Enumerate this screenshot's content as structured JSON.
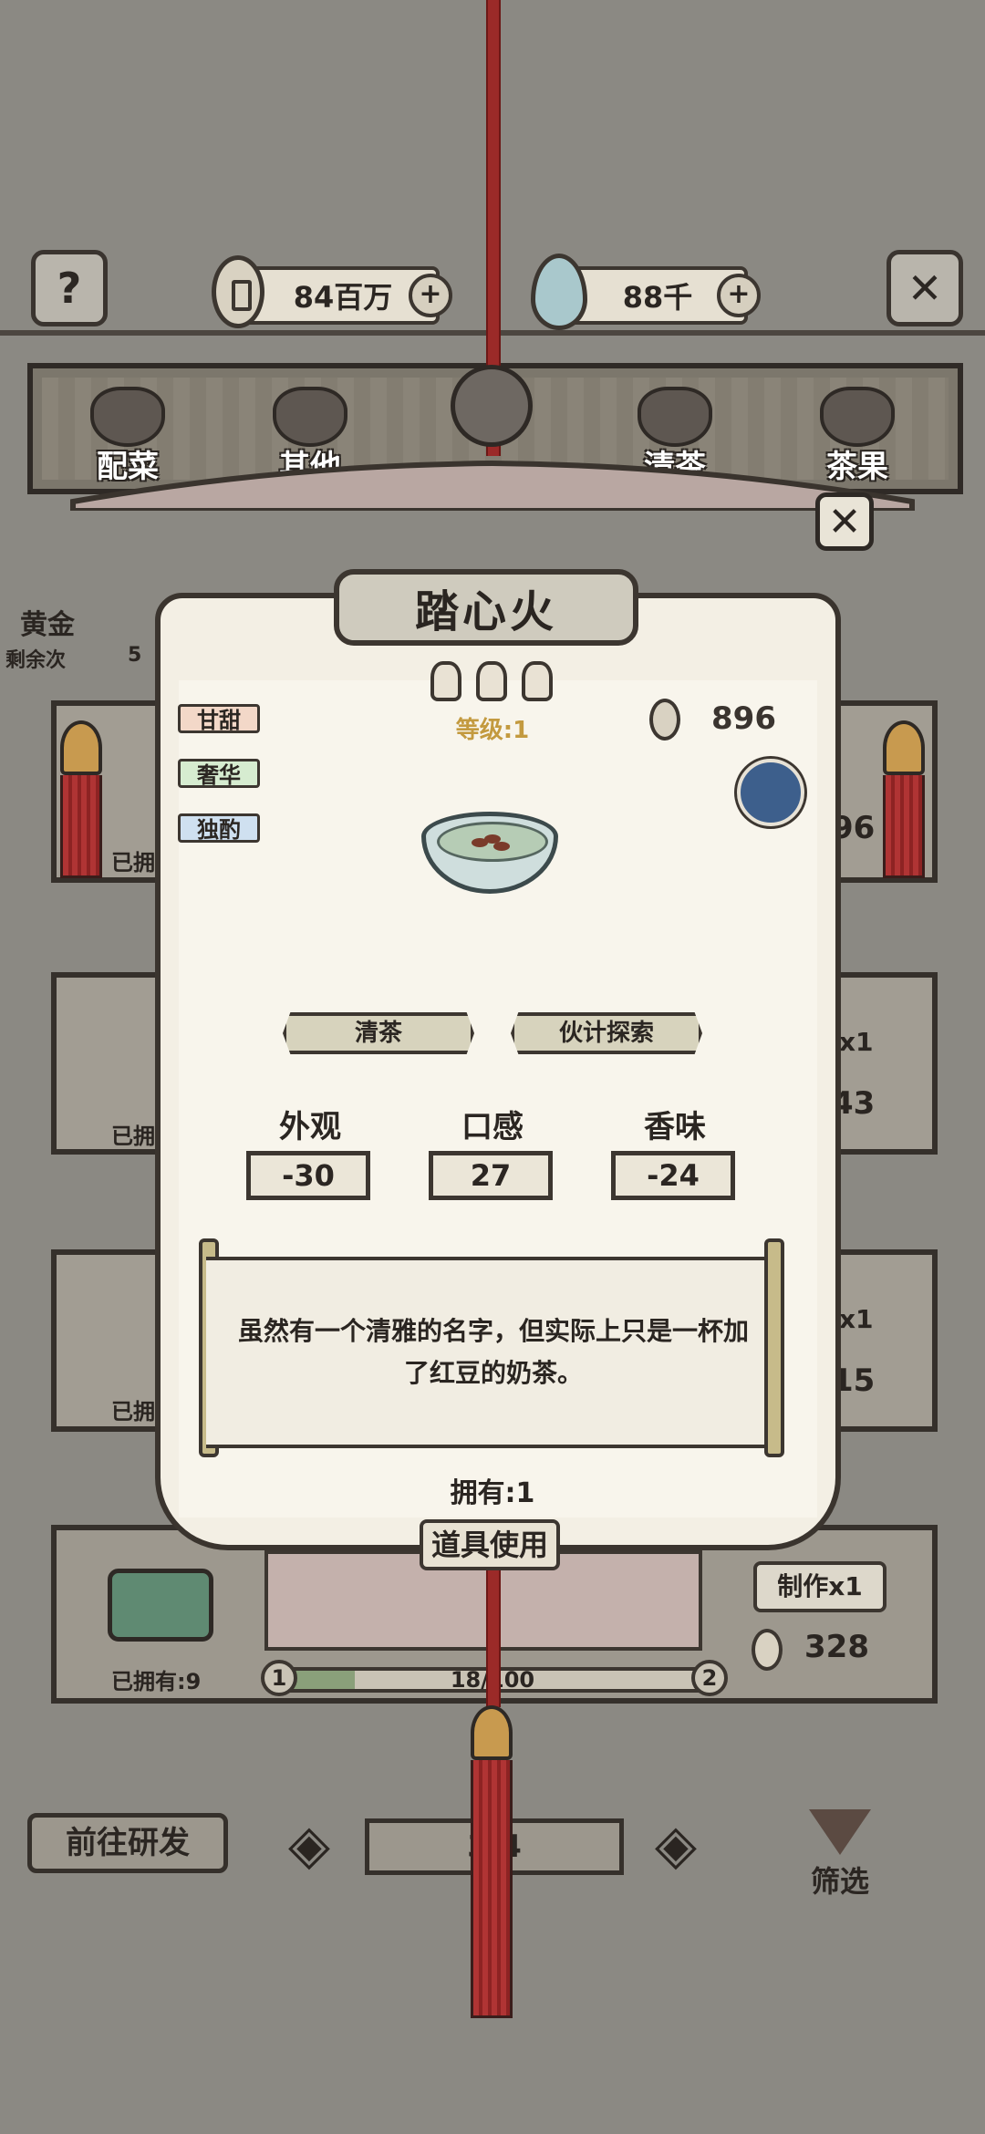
{
  "topbar": {
    "help_icon": "question-icon",
    "coins": "84百万",
    "gems": "88千",
    "close_icon": "close-icon"
  },
  "categories": [
    {
      "label": "配菜",
      "icon": "side-dish-icon"
    },
    {
      "label": "其他",
      "icon": "mortar-icon"
    },
    {
      "label": "清茶",
      "icon": "tea-bowl-icon"
    },
    {
      "label": "茶果",
      "icon": "tea-snack-icon"
    }
  ],
  "background": {
    "left_item_label": "黄金",
    "left_item_sub": "剩余次",
    "left_item_count": "5",
    "card1_owned": "已拥",
    "card1_value": "96",
    "card2_owned": "已拥",
    "card2_make": "x1",
    "card2_value": "43",
    "card3_owned": "已拥",
    "card3_make": "x1",
    "card3_value": "15"
  },
  "dialog": {
    "title": "踏心火",
    "level": "等级:1",
    "price": "896",
    "tags": [
      "甘甜",
      "奢华",
      "独酌"
    ],
    "tag_colors": [
      "#f3d8c8",
      "#d6ecd0",
      "#cfe0f0"
    ],
    "buttons": [
      "清茶",
      "伙计探索"
    ],
    "stats": [
      {
        "label": "外观",
        "value": "-30"
      },
      {
        "label": "口感",
        "value": "27"
      },
      {
        "label": "香味",
        "value": "-24"
      }
    ],
    "description": "虽然有一个清雅的名字，但实际上只是一杯加了红豆的奶茶。",
    "owned": "拥有:1",
    "use_button": "道具使用"
  },
  "bottom_card": {
    "owned": "已拥有:9",
    "make_button": "制作x1",
    "price": "328",
    "progress_text": "18/100",
    "progress_fraction": 0.18,
    "level_from": "1",
    "level_to": "2"
  },
  "footer": {
    "research_button": "前往研发",
    "page": "3/4",
    "filter": "筛选"
  }
}
